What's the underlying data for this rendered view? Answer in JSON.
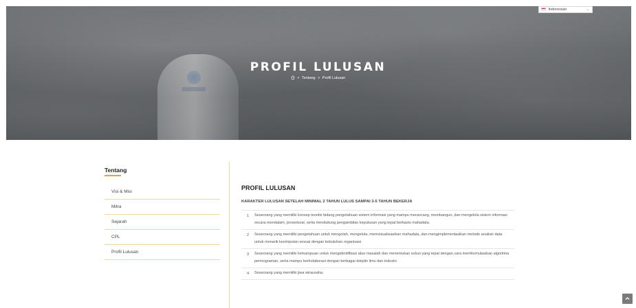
{
  "hero": {
    "title": "PROFIL LULUSAN",
    "breadcrumb": {
      "separator": ">",
      "items": [
        "Tentang",
        "Profil Lulusan"
      ]
    }
  },
  "language_selector": {
    "selected": "Indonesian",
    "flag_icon": "indonesia-flag-icon"
  },
  "sidebar": {
    "title": "Tentang",
    "items": [
      {
        "label": "Visi & Misi"
      },
      {
        "label": "Mitra"
      },
      {
        "label": "Sejarah"
      },
      {
        "label": "CPL"
      },
      {
        "label": "Profil Lulusan"
      }
    ]
  },
  "main": {
    "title": "PROFIL LULUSAN",
    "subtitle": "KARAKTER LULUSAN SETELAH MINIMAL 2 TAHUN LULUS SAMPAI 3-5 TAHUN BEKERJA",
    "rows": [
      {
        "num": "1",
        "text": "Seseorang yang memiliki konsep teoritis bidang pengetahuan sistem informasi yang mampu merancang, membangun, dan mengelola sistem informasi secara mendalam, prosedural, serta mendukung pengambilan keputusan yang tepat berbasis mahadata."
      },
      {
        "num": "2",
        "text": "Seseorang yang memiliki pengetahuan untuk mengolah, mengelola, memvisualisasikan mahadata, dan mengimplementasikan metode analisis data untuk menarik kesimpulan sesuai dengan kebutuhan organisasi."
      },
      {
        "num": "3",
        "text": "Seseorang yang memiliki kemampuan untuk mengidentifikasi akar masalah dan menemukan solusi yang tepat dengan cara memformulasikan algoritma pemrograman, serta mampu berkolaborasi dengan berbagai disiplin ilmu dan industri."
      },
      {
        "num": "4",
        "text": "Seseorang yang memiliki jiwa wirausaha."
      }
    ]
  },
  "colors": {
    "accent": "#f0a030",
    "divider": "#f3d3a0"
  }
}
